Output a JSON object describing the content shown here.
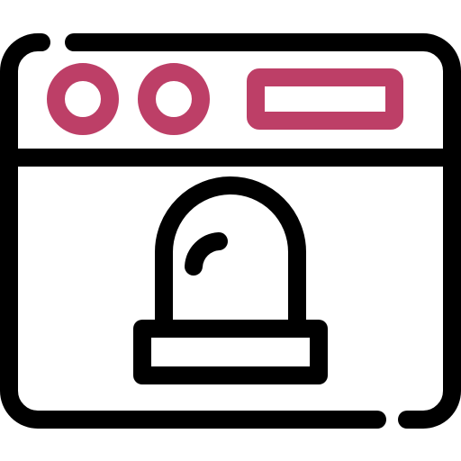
{
  "icon": {
    "name": "browser-window-alarm-icon",
    "colors": {
      "outline": "#000000",
      "accent": "#BD3F67",
      "background": "#FFFFFF"
    },
    "parts": [
      "browser-window-frame",
      "title-bar",
      "window-control-dot-1",
      "window-control-dot-2",
      "address-bar",
      "alarm-siren-light"
    ]
  }
}
